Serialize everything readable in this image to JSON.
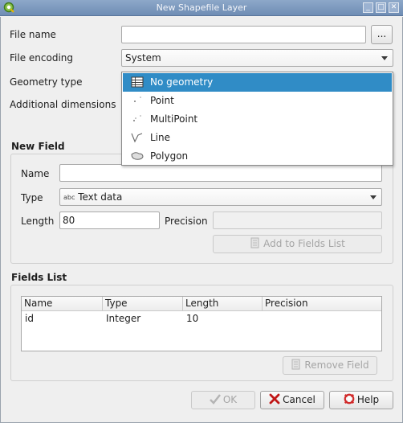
{
  "window": {
    "title": "New Shapefile Layer"
  },
  "form": {
    "file_name_label": "File name",
    "file_name_value": "",
    "browse_label": "...",
    "encoding_label": "File encoding",
    "encoding_value": "System",
    "geometry_label": "Geometry type",
    "dimensions_label": "Additional dimensions"
  },
  "geometry_dropdown": {
    "items": [
      {
        "label": "No geometry",
        "icon": "table-icon",
        "selected": true
      },
      {
        "label": "Point",
        "icon": "point-icon"
      },
      {
        "label": "MultiPoint",
        "icon": "multipoint-icon"
      },
      {
        "label": "Line",
        "icon": "line-icon"
      },
      {
        "label": "Polygon",
        "icon": "polygon-icon"
      }
    ]
  },
  "new_field": {
    "title": "New Field",
    "name_label": "Name",
    "name_value": "",
    "type_label": "Type",
    "type_prefix": "abc",
    "type_value": "Text data",
    "length_label": "Length",
    "length_value": "80",
    "precision_label": "Precision",
    "precision_value": "",
    "add_button": "Add to Fields List"
  },
  "fields_list": {
    "title": "Fields List",
    "columns": [
      "Name",
      "Type",
      "Length",
      "Precision"
    ],
    "rows": [
      {
        "name": "id",
        "type": "Integer",
        "length": "10",
        "precision": ""
      }
    ],
    "remove_button": "Remove Field"
  },
  "buttons": {
    "ok": "OK",
    "cancel": "Cancel",
    "help": "Help"
  },
  "colors": {
    "title_bar": "#7a96bd",
    "selection": "#308cc6"
  }
}
